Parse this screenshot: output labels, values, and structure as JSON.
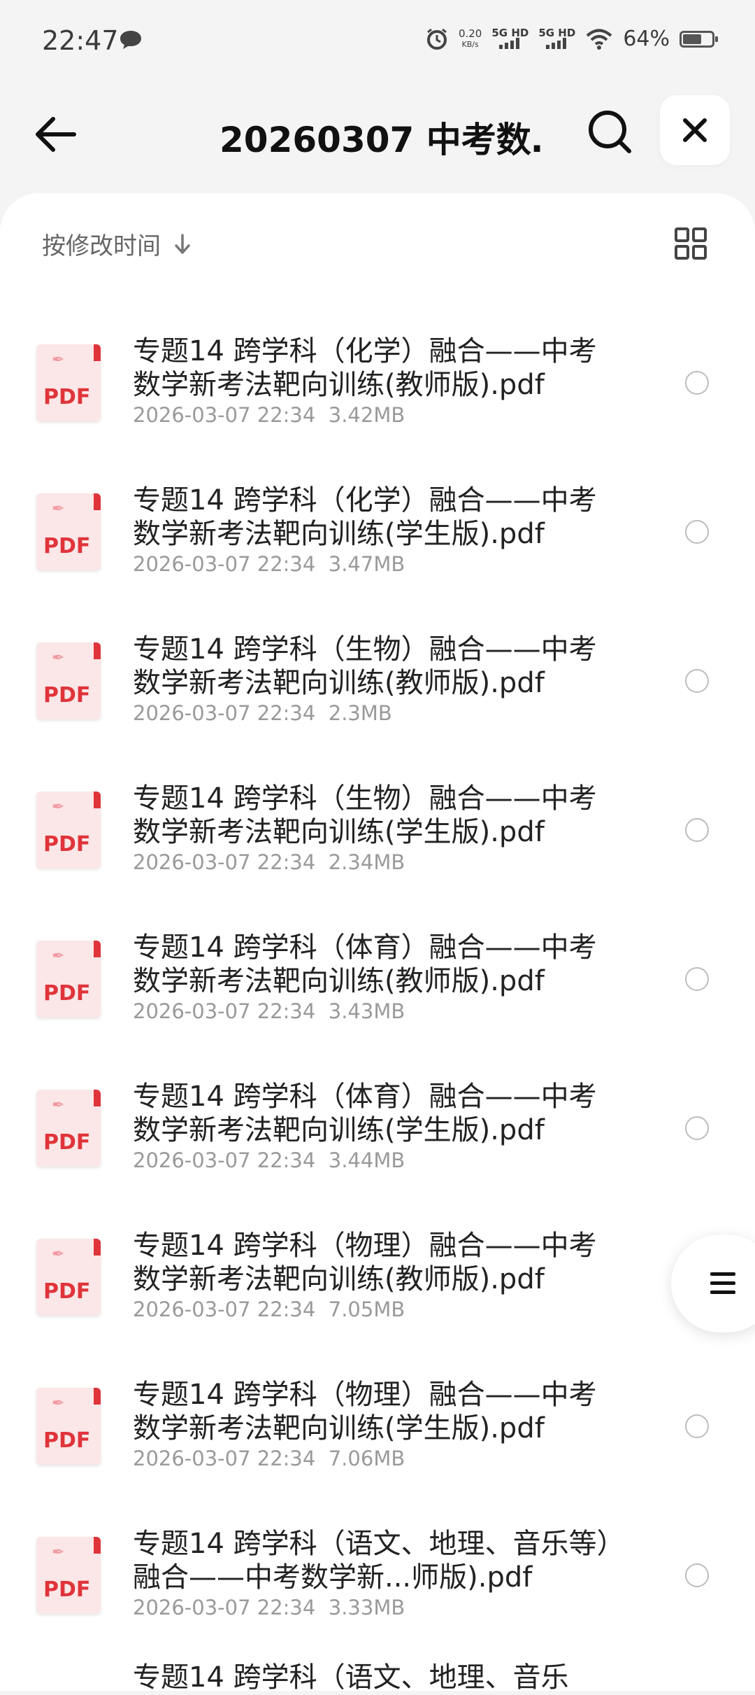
{
  "status_bar": {
    "time": "22:47",
    "net_speed_value": "0.20",
    "net_speed_unit": "KB/s",
    "sim1": "5G HD",
    "sim2": "5G HD",
    "battery_text": "64%",
    "battery_level": 0.64,
    "icons": [
      "message-icon",
      "alarm-icon",
      "signal-icon",
      "wifi-icon",
      "battery-icon"
    ]
  },
  "header": {
    "title": "20260307  中考数…",
    "icons": [
      "back-arrow-icon",
      "search-icon",
      "close-icon"
    ]
  },
  "toolbar": {
    "sort_label": "按修改时间",
    "icons": [
      "sort-down-icon",
      "grid-view-icon"
    ]
  },
  "files": [
    {
      "name": "专题14 跨学科（化学）融合——中考数学新考法靶向训练(教师版).pdf",
      "date": "2026-03-07 22:34",
      "size": "3.42MB",
      "icon_label": "PDF"
    },
    {
      "name": "专题14 跨学科（化学）融合——中考数学新考法靶向训练(学生版).pdf",
      "date": "2026-03-07 22:34",
      "size": "3.47MB",
      "icon_label": "PDF"
    },
    {
      "name": "专题14 跨学科（生物）融合——中考数学新考法靶向训练(教师版).pdf",
      "date": "2026-03-07 22:34",
      "size": "2.3MB",
      "icon_label": "PDF"
    },
    {
      "name": "专题14 跨学科（生物）融合——中考数学新考法靶向训练(学生版).pdf",
      "date": "2026-03-07 22:34",
      "size": "2.34MB",
      "icon_label": "PDF"
    },
    {
      "name": "专题14 跨学科（体育）融合——中考数学新考法靶向训练(教师版).pdf",
      "date": "2026-03-07 22:34",
      "size": "3.43MB",
      "icon_label": "PDF"
    },
    {
      "name": "专题14 跨学科（体育）融合——中考数学新考法靶向训练(学生版).pdf",
      "date": "2026-03-07 22:34",
      "size": "3.44MB",
      "icon_label": "PDF"
    },
    {
      "name": "专题14 跨学科（物理）融合——中考数学新考法靶向训练(教师版).pdf",
      "date": "2026-03-07 22:34",
      "size": "7.05MB",
      "icon_label": "PDF"
    },
    {
      "name": "专题14 跨学科（物理）融合——中考数学新考法靶向训练(学生版).pdf",
      "date": "2026-03-07 22:34",
      "size": "7.06MB",
      "icon_label": "PDF"
    },
    {
      "name": "专题14 跨学科（语文、地理、音乐等）融合——中考数学新...师版).pdf",
      "date": "2026-03-07 22:34",
      "size": "3.33MB",
      "icon_label": "PDF"
    }
  ],
  "partial_file_name": "专题14 跨学科（语文、地理、音乐",
  "fab": {
    "icon": "menu-icon"
  },
  "colors": {
    "pdf_red": "#e0343b",
    "background": "#f4f4f4",
    "panel": "#ffffff"
  }
}
